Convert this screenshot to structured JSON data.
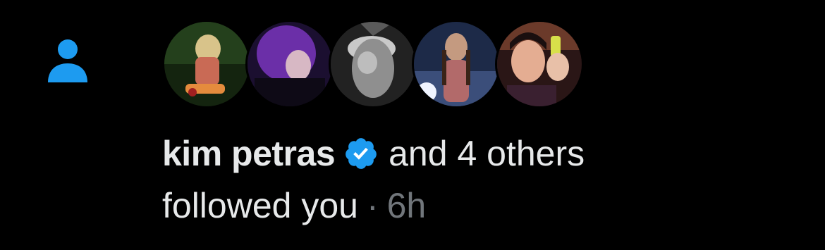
{
  "notification": {
    "type_icon": "person-icon",
    "accent_color": "#1d9bf0",
    "avatars": [
      {
        "name": "avatar-1",
        "colors": [
          "#1f3a1c",
          "#c9b07a",
          "#d86a3a"
        ]
      },
      {
        "name": "avatar-2",
        "colors": [
          "#2a1a4a",
          "#7a3fbf",
          "#d9a0c8"
        ]
      },
      {
        "name": "avatar-3",
        "colors": [
          "#1a1a1a",
          "#9a9a9a",
          "#e0e0e0"
        ]
      },
      {
        "name": "avatar-4",
        "colors": [
          "#1a2240",
          "#c9a88a",
          "#e8eef8"
        ]
      },
      {
        "name": "avatar-5",
        "colors": [
          "#3a1e1e",
          "#e8b090",
          "#c6d84a"
        ]
      }
    ],
    "user_name": "kim petras",
    "verified": true,
    "others_text": "and 4 others",
    "action_text": "followed you",
    "separator": "·",
    "time": "6h"
  }
}
